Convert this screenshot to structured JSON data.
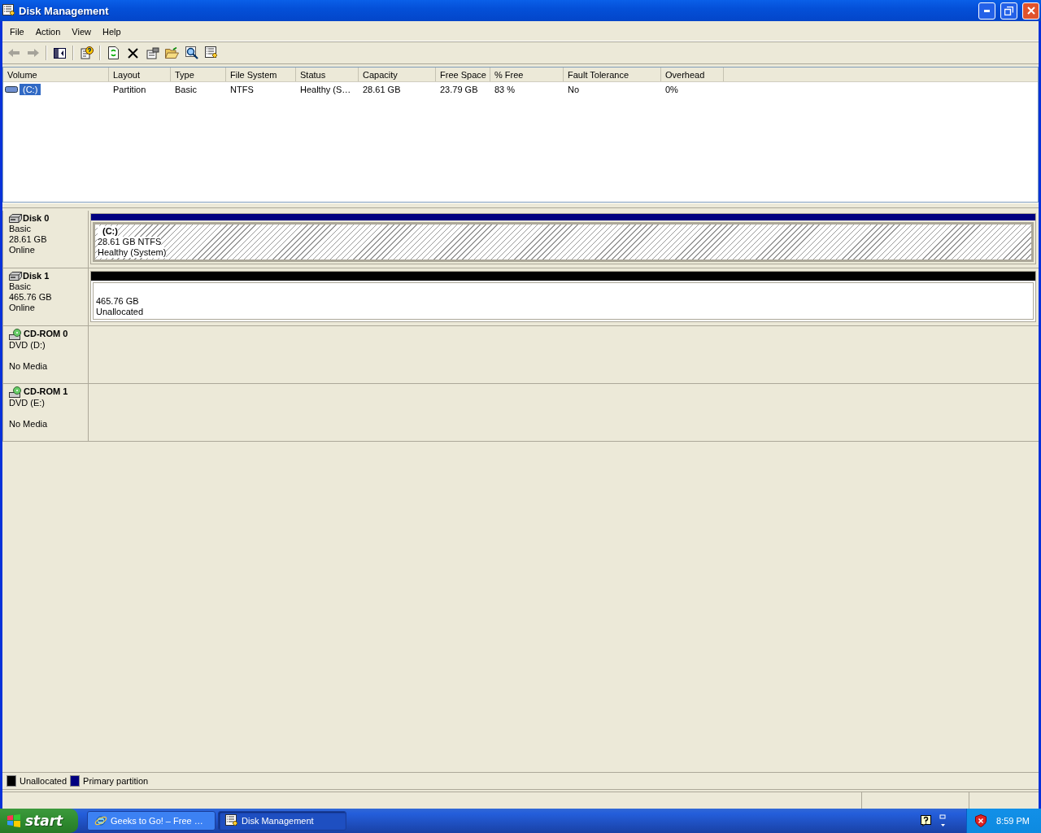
{
  "window": {
    "title": "Disk Management"
  },
  "menu": [
    "File",
    "Action",
    "View",
    "Help"
  ],
  "toolbar": [
    {
      "kind": "back",
      "disabled": true
    },
    {
      "kind": "forward",
      "disabled": true
    },
    {
      "kind": "panel",
      "disabled": false
    },
    {
      "kind": "help",
      "disabled": false
    },
    {
      "kind": "refresh",
      "disabled": false
    },
    {
      "kind": "delete",
      "disabled": false
    },
    {
      "kind": "properties",
      "disabled": false
    },
    {
      "kind": "open",
      "disabled": false
    },
    {
      "kind": "search",
      "disabled": false
    },
    {
      "kind": "export",
      "disabled": false
    }
  ],
  "volume_table": {
    "columns": [
      "Volume",
      "Layout",
      "Type",
      "File System",
      "Status",
      "Capacity",
      "Free Space",
      "% Free",
      "Fault Tolerance",
      "Overhead"
    ],
    "rows": [
      {
        "selected": true,
        "cells": [
          "(C:)",
          "Partition",
          "Basic",
          "NTFS",
          "Healthy (S…",
          "28.61 GB",
          "23.79 GB",
          "83 %",
          "No",
          "0%"
        ]
      }
    ]
  },
  "disks": [
    {
      "kind": "disk",
      "name": "Disk 0",
      "type": "Basic",
      "size": "28.61 GB",
      "status": "Online",
      "partitions": [
        {
          "kind": "primary",
          "selected": true,
          "label": "(C:)",
          "size": "28.61 GB NTFS",
          "status": "Healthy (System)"
        }
      ]
    },
    {
      "kind": "disk",
      "name": "Disk 1",
      "type": "Basic",
      "size": "465.76 GB",
      "status": "Online",
      "partitions": [
        {
          "kind": "unallocated",
          "selected": false,
          "size": "465.76 GB",
          "status": "Unallocated"
        }
      ]
    },
    {
      "kind": "cdrom",
      "name": "CD-ROM 0",
      "type": "DVD (D:)",
      "status": "No Media"
    },
    {
      "kind": "cdrom",
      "name": "CD-ROM 1",
      "type": "DVD (E:)",
      "status": "No Media"
    }
  ],
  "legend": [
    {
      "label": "Unallocated",
      "color": "#000000"
    },
    {
      "label": "Primary partition",
      "color": "#000080"
    }
  ],
  "taskbar": {
    "start": "start",
    "tasks": [
      {
        "kind": "browser",
        "label": "Geeks to Go! – Free …",
        "selected": false
      },
      {
        "kind": "disk",
        "label": "Disk Management",
        "selected": true
      }
    ],
    "clock": "8:59 PM"
  }
}
